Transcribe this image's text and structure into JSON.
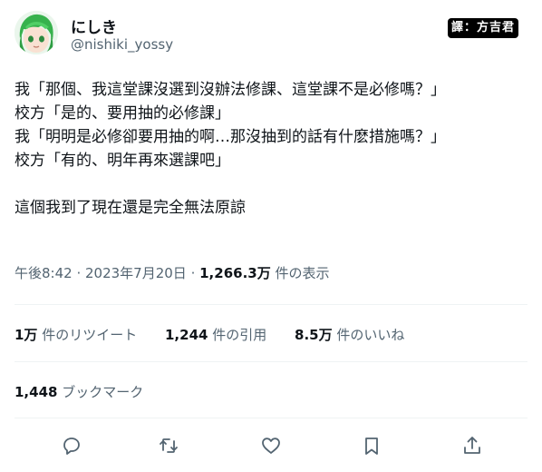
{
  "author": {
    "name": "にしき",
    "handle": "@nishiki_yossy",
    "avatar_icon": "anime-avatar-icon"
  },
  "watermark": "譯：方吉君",
  "tweet_lines": [
    "我「那個、我這堂課沒選到沒辦法修課、這堂課不是必修嗎？」",
    "校方「是的、要用抽的必修課」",
    "我「明明是必修卻要用抽的啊…那沒抽到的話有什麽措施嗎？」",
    "校方「有的、明年再來選課吧」",
    "",
    "這個我到了現在還是完全無法原諒"
  ],
  "meta": {
    "time": "午後8:42",
    "sep1": " · ",
    "date": "2023年7月20日",
    "sep2": " · ",
    "views_count": "1,266.3万",
    "views_label": " 件の表示"
  },
  "stats": {
    "retweets_count": "1万",
    "retweets_label": " 件のリツイート",
    "quotes_count": "1,244",
    "quotes_label": " 件の引用",
    "likes_count": "8.5万",
    "likes_label": " 件のいいね"
  },
  "bookmarks": {
    "count": "1,448",
    "label": " ブックマーク"
  },
  "actions": {
    "reply": "reply-icon",
    "retweet": "retweet-icon",
    "like": "heart-icon",
    "bookmark": "bookmark-icon",
    "share": "share-icon"
  },
  "colors": {
    "text": "#0f1419",
    "secondary": "#536471",
    "divider": "#eff3f4",
    "avatar_hair": "#3fbf5a"
  }
}
